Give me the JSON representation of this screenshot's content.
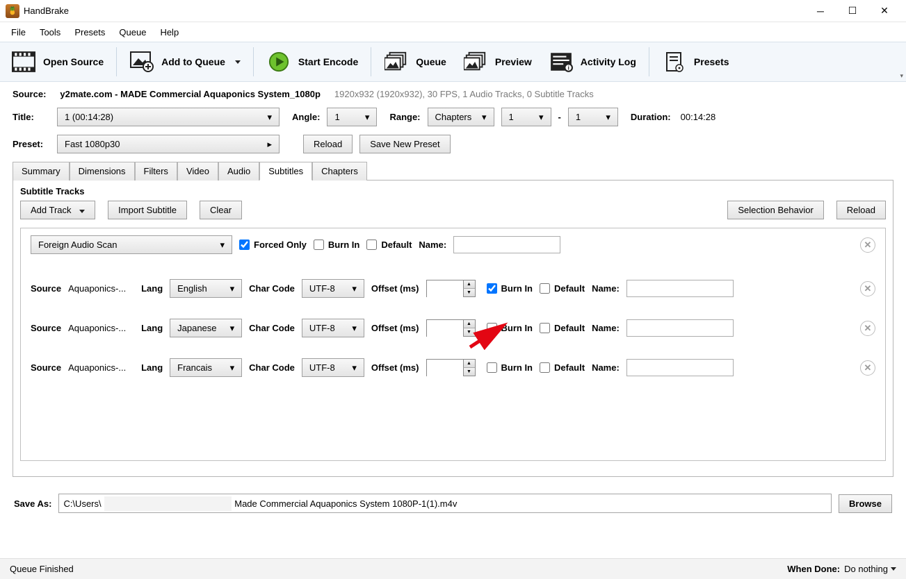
{
  "app": {
    "title": "HandBrake"
  },
  "menu": [
    "File",
    "Tools",
    "Presets",
    "Queue",
    "Help"
  ],
  "toolbar": {
    "open_source": "Open Source",
    "add_queue": "Add to Queue",
    "start_encode": "Start Encode",
    "queue": "Queue",
    "preview": "Preview",
    "activity_log": "Activity Log",
    "presets": "Presets"
  },
  "source": {
    "label": "Source:",
    "name": "y2mate.com - MADE Commercial Aquaponics System_1080p",
    "meta": "1920x932 (1920x932), 30 FPS, 1 Audio Tracks, 0 Subtitle Tracks"
  },
  "title_row": {
    "title_label": "Title:",
    "title_value": "1  (00:14:28)",
    "angle_label": "Angle:",
    "angle_value": "1",
    "range_label": "Range:",
    "range_mode": "Chapters",
    "range_from": "1",
    "range_dash": "-",
    "range_to": "1",
    "duration_label": "Duration:",
    "duration_value": "00:14:28"
  },
  "preset": {
    "label": "Preset:",
    "value": "Fast 1080p30",
    "reload": "Reload",
    "save_new": "Save New Preset"
  },
  "tabs": [
    "Summary",
    "Dimensions",
    "Filters",
    "Video",
    "Audio",
    "Subtitles",
    "Chapters"
  ],
  "subtitles": {
    "heading": "Subtitle Tracks",
    "add_track": "Add Track",
    "import": "Import Subtitle",
    "clear": "Clear",
    "selection_behavior": "Selection Behavior",
    "reload": "Reload",
    "first": {
      "source_value": "Foreign Audio Scan",
      "forced_only": "Forced Only",
      "burn_in": "Burn In",
      "default": "Default",
      "name_label": "Name:"
    },
    "row_labels": {
      "source": "Source",
      "lang": "Lang",
      "char": "Char Code",
      "offset": "Offset (ms)",
      "burn": "Burn In",
      "default": "Default",
      "name": "Name:"
    },
    "rows": [
      {
        "source_val": "Aquaponics-...",
        "lang": "English",
        "char": "UTF-8",
        "burn": true,
        "default": false
      },
      {
        "source_val": "Aquaponics-...",
        "lang": "Japanese",
        "char": "UTF-8",
        "burn": false,
        "default": false
      },
      {
        "source_val": "Aquaponics-...",
        "lang": "Francais",
        "char": "UTF-8",
        "burn": false,
        "default": false
      }
    ]
  },
  "save": {
    "label": "Save As:",
    "prefix": "C:\\Users\\",
    "suffix": "Made Commercial Aquaponics System 1080P-1(1).m4v",
    "browse": "Browse"
  },
  "status": {
    "left": "Queue Finished",
    "when_done_label": "When Done:",
    "when_done_value": "Do nothing"
  }
}
